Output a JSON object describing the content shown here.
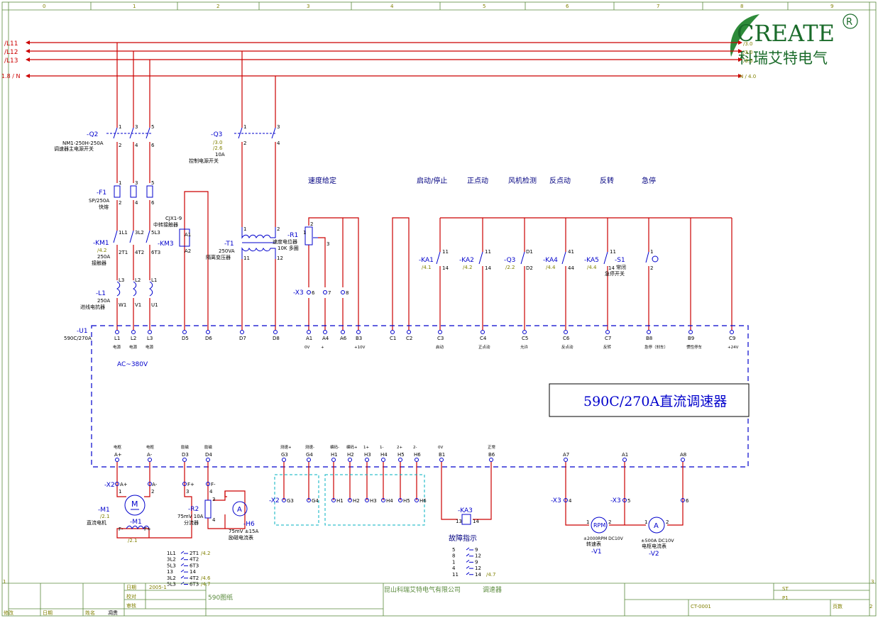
{
  "logo": {
    "brand": "CREATE",
    "registered": "R",
    "company_cn": "科瑞艾特电气"
  },
  "columns": [
    "0",
    "1",
    "2",
    "3",
    "4",
    "5",
    "6",
    "7",
    "8",
    "9"
  ],
  "rows": [
    "1",
    "2",
    "3"
  ],
  "buses": {
    "left": [
      "/L11",
      "/L12",
      "/L13",
      "1.8 / N"
    ],
    "right_ref_L": [
      "/3.0",
      "/3.0",
      "/3.0"
    ],
    "right_ref_N": "N / 4.0",
    "right_L": [
      "L11",
      "L12",
      "L13"
    ]
  },
  "section_titles": {
    "speed_setting": "速度给定",
    "start_stop": "启动/停止",
    "jog_fwd": "正点动",
    "fan_check": "风机检测",
    "jog_rev": "反点动",
    "reverse": "反转",
    "estop": "急停"
  },
  "q2": {
    "tag": "-Q2",
    "model": "NM1-250H-250A",
    "desc": "调速器主电源开关",
    "pins_top": [
      "1",
      "3",
      "5"
    ],
    "pins_bot": [
      "2",
      "4",
      "6"
    ]
  },
  "q3": {
    "tag": "-Q3",
    "refs": [
      "/3.0",
      "/2.6"
    ],
    "rating": "10A",
    "desc": "控制电源开关",
    "pins_top": [
      "1",
      "3"
    ],
    "pins_bot": [
      "2",
      "4"
    ]
  },
  "f1": {
    "tag": "-F1",
    "model": "SP/250A",
    "desc": "快熔",
    "pins_top": [
      "1",
      "3",
      "5"
    ],
    "pins_bot": [
      "2",
      "4",
      "6"
    ]
  },
  "km1": {
    "tag": "-KM1",
    "ref": "/4.2",
    "rating": "250A",
    "desc": "接触器",
    "pins_top": [
      "1L1",
      "3L2",
      "5L3"
    ],
    "pins_bot": [
      "2T1",
      "4T2",
      "6T3"
    ]
  },
  "km3": {
    "tag": "-KM3",
    "model": "CJX1-9",
    "desc": "中转接触器",
    "pins": [
      "A1",
      "A2"
    ]
  },
  "l1": {
    "tag": "-L1",
    "rating": "250A",
    "desc": "进线电抗器",
    "pins_top": [
      "L3",
      "L2",
      "L1"
    ],
    "pins_bot": [
      "W1",
      "V1",
      "U1"
    ]
  },
  "t1": {
    "tag": "-T1",
    "rating": "250VA",
    "desc": "隔离变压器",
    "pins": [
      "1",
      "2",
      "11",
      "12"
    ]
  },
  "r1": {
    "tag": "-R1",
    "desc1": "速度电位器",
    "desc2": "10K 多圈",
    "pins": [
      "1",
      "2",
      "3"
    ]
  },
  "x3_top": {
    "tag": "-X3",
    "pins": [
      "6",
      "7",
      "8"
    ]
  },
  "relays": [
    {
      "tag": "-KA1",
      "ref": "/4.1",
      "pins": [
        "11",
        "14"
      ]
    },
    {
      "tag": "-KA2",
      "ref": "/4.2",
      "pins": [
        "11",
        "14"
      ]
    },
    {
      "tag": "-Q3",
      "ref": "/2.2",
      "pins": [
        "D1",
        "D2"
      ]
    },
    {
      "tag": "-KA4",
      "ref": "/4.4",
      "pins": [
        "41",
        "44"
      ]
    },
    {
      "tag": "-KA5",
      "ref": "/4.4",
      "pins": [
        "11",
        "14"
      ]
    }
  ],
  "s1": {
    "tag": "-S1",
    "desc1": "常闭",
    "desc2": "急停开关",
    "pins": [
      "1",
      "2"
    ]
  },
  "u1": {
    "tag": "-U1",
    "model": "590C/270A",
    "title": "590C/270A直流调速器",
    "ac": "AC~380V"
  },
  "u1_top_terminals": [
    {
      "id": "L1",
      "label": "电源"
    },
    {
      "id": "L2",
      "label": "电源"
    },
    {
      "id": "L3",
      "label": "电源"
    },
    {
      "id": "D5",
      "label": ""
    },
    {
      "id": "D6",
      "label": ""
    },
    {
      "id": "D7",
      "label": ""
    },
    {
      "id": "D8",
      "label": ""
    },
    {
      "id": "A1",
      "label": "0V"
    },
    {
      "id": "A4",
      "label": "+"
    },
    {
      "id": "A6",
      "label": ""
    },
    {
      "id": "B3",
      "label": "+10V"
    },
    {
      "id": "C1",
      "label": ""
    },
    {
      "id": "C2",
      "label": ""
    },
    {
      "id": "C3",
      "label": "启动"
    },
    {
      "id": "C4",
      "label": "正点动"
    },
    {
      "id": "C5",
      "label": "允许"
    },
    {
      "id": "C6",
      "label": "反点动"
    },
    {
      "id": "C7",
      "label": "反转"
    },
    {
      "id": "B8",
      "label": "急停（刹车）"
    },
    {
      "id": "B9",
      "label": "惯性停车"
    },
    {
      "id": "C9",
      "label": "+24V"
    }
  ],
  "u1_bot_terminals": [
    {
      "id": "A+",
      "label": "电枢"
    },
    {
      "id": "A-",
      "label": "电枢"
    },
    {
      "id": "D3",
      "label": "励磁"
    },
    {
      "id": "D4",
      "label": "励磁"
    },
    {
      "id": "G3",
      "label": "测速+"
    },
    {
      "id": "G4",
      "label": "测速-"
    },
    {
      "id": "H1",
      "label": "编码-"
    },
    {
      "id": "H2",
      "label": "编码+"
    },
    {
      "id": "H3",
      "label": "1+"
    },
    {
      "id": "H4",
      "label": "1-"
    },
    {
      "id": "H5",
      "label": "2+"
    },
    {
      "id": "H6",
      "label": "2-"
    },
    {
      "id": "B1",
      "label": "0V"
    },
    {
      "id": "B6",
      "label": "正常"
    },
    {
      "id": "A7",
      "label": ""
    },
    {
      "id": "A1",
      "label": ""
    },
    {
      "id": "A8",
      "label": ""
    }
  ],
  "x2_left": {
    "tag": "-X2",
    "pins": [
      "1",
      "2",
      "3",
      "4"
    ],
    "labels": [
      "A+",
      "A-",
      "F+",
      "F-"
    ]
  },
  "m1": {
    "tag": "-M1",
    "ref": "/2.1",
    "desc": "直流电机",
    "symbol": "M",
    "field_tag": "-M1",
    "field_ref": "/2.1",
    "f_minus": "F-",
    "f_plus": "F+"
  },
  "r2": {
    "tag": "-R2",
    "desc1": "75mV 10A",
    "desc2": "分流器",
    "pins": [
      "1",
      "2",
      "3",
      "4"
    ]
  },
  "h6": {
    "tag": "-H6",
    "desc1": "75mV ±15A",
    "desc2": "励磁电流表",
    "symbol": "A"
  },
  "x2_mid": {
    "tag": "-X2",
    "pins": [
      "G3",
      "G4",
      "H1",
      "H2",
      "H3",
      "H4",
      "H5",
      "H6"
    ]
  },
  "ka3": {
    "tag": "-KA3",
    "pins": [
      "13",
      "14"
    ],
    "desc": "故障指示"
  },
  "x3_bot": {
    "tag": "-X3",
    "pins": [
      "4",
      "5",
      "6"
    ],
    "tag2": "-X3"
  },
  "v1": {
    "tag": "-V1",
    "symbol": "RPM",
    "desc1": "±2000RPM DC10V",
    "desc2": "转速表",
    "pins": [
      "1",
      "2"
    ]
  },
  "v2": {
    "tag": "-V2",
    "symbol": "A",
    "desc1": "±500A DC10V",
    "desc2": "电枢电流表",
    "pins": [
      "1",
      "2"
    ]
  },
  "km1_contacts": [
    {
      "left": "1L1",
      "right": "2T1",
      "ref": "/4.2"
    },
    {
      "left": "3L2",
      "right": "4T2",
      "ref": ""
    },
    {
      "left": "5L3",
      "right": "6T3",
      "ref": ""
    },
    {
      "left": "13",
      "right": "14",
      "ref": ""
    },
    {
      "left": "3L2",
      "right": "4T2",
      "ref": "/4.6"
    },
    {
      "left": "5L3",
      "right": "6T3",
      "ref": "/4.7"
    }
  ],
  "ka3_contacts": [
    {
      "left": "5",
      "right": "9",
      "ref": ""
    },
    {
      "left": "8",
      "right": "12",
      "ref": ""
    },
    {
      "left": "1",
      "right": "9",
      "ref": ""
    },
    {
      "left": "4",
      "right": "12",
      "ref": ""
    },
    {
      "left": "11",
      "right": "14",
      "ref": "/4.7"
    }
  ],
  "title_block": {
    "date_label": "日期",
    "check_label": "校对",
    "review_label": "审核",
    "date_val": "2005-1",
    "drawing_name": "590图纸",
    "company": "昆山科瑞艾特电气有限公司",
    "product": "调速器",
    "doc_no": "CT-0001",
    "st": "ST",
    "p1": "P1",
    "page_label": "页数",
    "page_no": "2",
    "rev_label": "修改",
    "date2": "日期",
    "name_label": "姓名",
    "name_val": "凋贵"
  }
}
